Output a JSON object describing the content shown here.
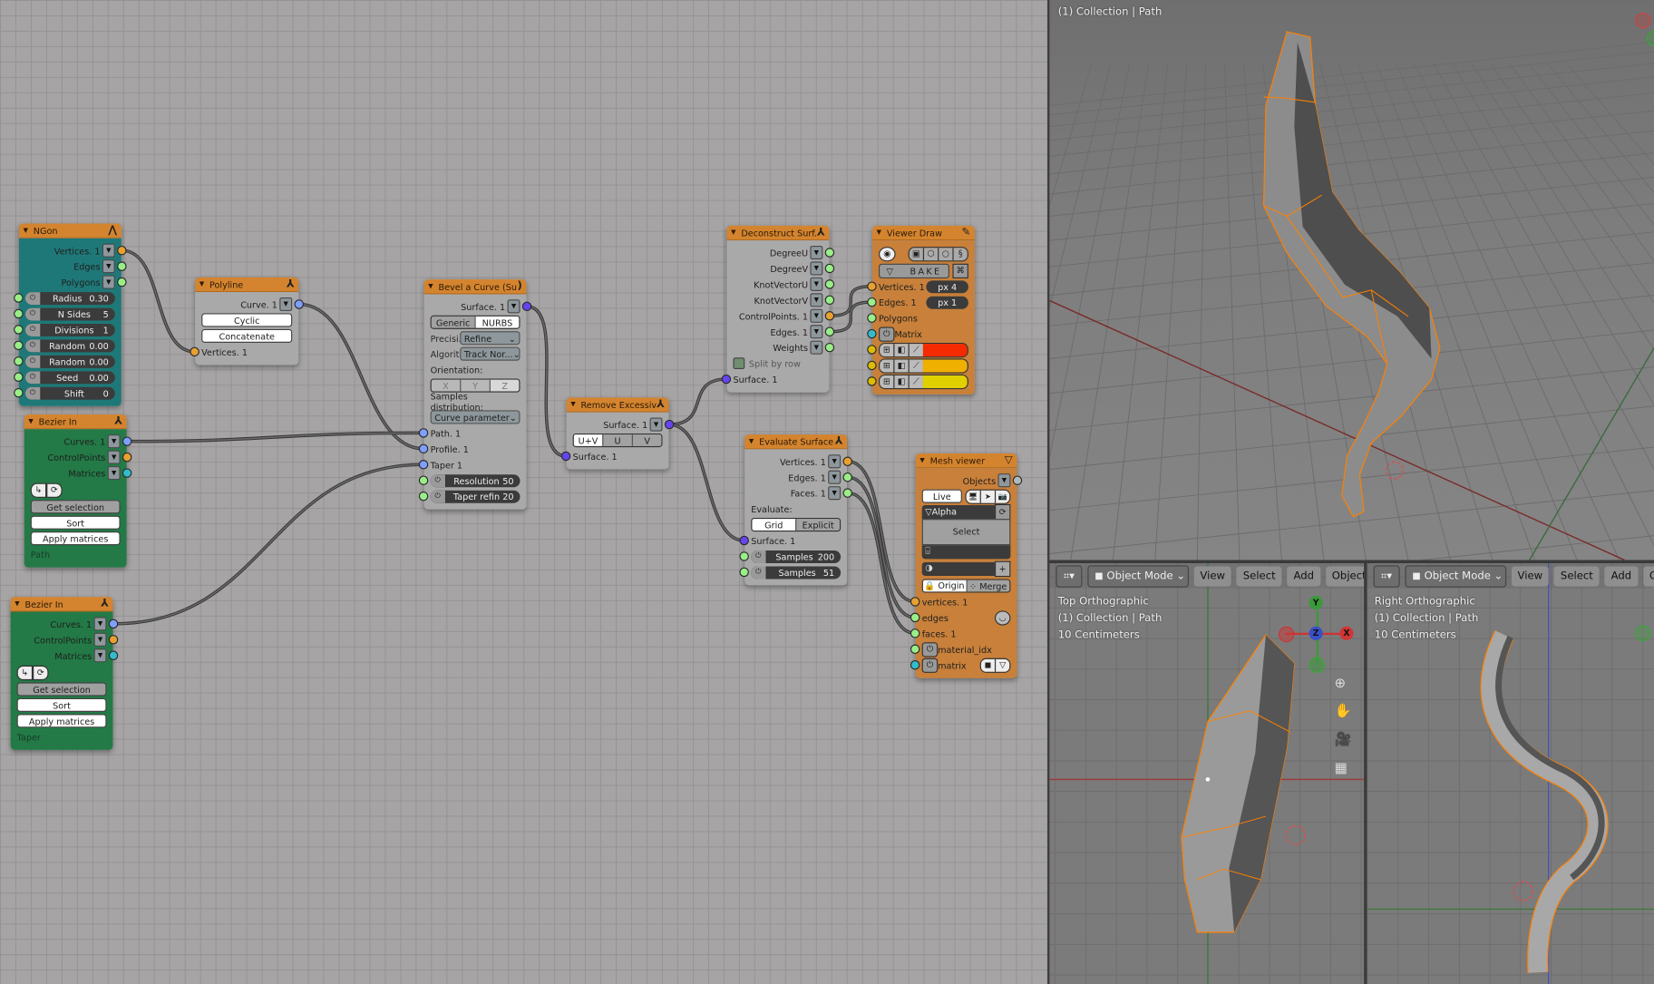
{
  "node_editor": {
    "nodes": [
      {
        "id": "ngon",
        "title": "NGon",
        "header_icon": "ngon-icon",
        "body_color": "#1f7878",
        "rows": [
          {
            "type": "out",
            "label": "Vertices. 1",
            "socket": "#e8a030",
            "s": "verts"
          },
          {
            "type": "out",
            "label": "Edges",
            "socket": "#99ee88",
            "s": "edges"
          },
          {
            "type": "out",
            "label": "Polygons",
            "socket": "#99ee88",
            "s": "polys"
          },
          {
            "type": "slider",
            "label": "Radius",
            "value": "0.30",
            "socket": "#99ee88"
          },
          {
            "type": "slider",
            "label": "N Sides",
            "value": "5",
            "socket": "#99ee88"
          },
          {
            "type": "slider",
            "label": "Divisions",
            "value": "1",
            "socket": "#99ee88"
          },
          {
            "type": "slider",
            "label": "Random",
            "value": "0.00",
            "socket": "#99ee88"
          },
          {
            "type": "slider",
            "label": "Random",
            "value": "0.00",
            "socket": "#99ee88"
          },
          {
            "type": "slider",
            "label": "Seed",
            "value": "0.00",
            "socket": "#99ee88"
          },
          {
            "type": "slider",
            "label": "Shift",
            "value": "0",
            "socket": "#99ee88"
          }
        ]
      },
      {
        "id": "bez_path",
        "title": "Bezier In",
        "header_icon": "sverchok-icon",
        "body_color": "#237a46",
        "rows": [
          {
            "type": "out",
            "label": "Curves. 1",
            "socket": "#7f9fff",
            "s": "curves"
          },
          {
            "type": "out",
            "label": "ControlPoints",
            "socket": "#e8a030",
            "s": "cp"
          },
          {
            "type": "out",
            "label": "Matrices",
            "socket": "#33bbcc",
            "s": "mat"
          },
          {
            "type": "icons",
            "icons": [
              "sort-curve-icon",
              "cycle-icon"
            ]
          },
          {
            "type": "button",
            "label": "Get selection",
            "style": "grey"
          },
          {
            "type": "button",
            "label": "Sort",
            "style": "white"
          },
          {
            "type": "button",
            "label": "Apply matrices",
            "style": "white"
          },
          {
            "type": "text",
            "label": "Path"
          }
        ]
      },
      {
        "id": "bez_taper",
        "title": "Bezier In",
        "header_icon": "sverchok-icon",
        "body_color": "#237a46",
        "rows": [
          {
            "type": "out",
            "label": "Curves. 1",
            "socket": "#7f9fff",
            "s": "curves"
          },
          {
            "type": "out",
            "label": "ControlPoints",
            "socket": "#e8a030",
            "s": "cp"
          },
          {
            "type": "out",
            "label": "Matrices",
            "socket": "#33bbcc",
            "s": "mat"
          },
          {
            "type": "icons",
            "icons": [
              "sort-curve-icon",
              "cycle-icon"
            ]
          },
          {
            "type": "button",
            "label": "Get selection",
            "style": "grey"
          },
          {
            "type": "button",
            "label": "Sort",
            "style": "white"
          },
          {
            "type": "button",
            "label": "Apply matrices",
            "style": "white"
          },
          {
            "type": "text",
            "label": "Taper"
          }
        ]
      },
      {
        "id": "polyline",
        "title": "Polyline",
        "header_icon": "sverchok-icon",
        "body_color": "#a9a9a9",
        "rows": [
          {
            "type": "out",
            "label": "Curve. 1",
            "socket": "#7f9fff",
            "s": "curve"
          },
          {
            "type": "button",
            "label": "Cyclic",
            "style": "white"
          },
          {
            "type": "button",
            "label": "Concatenate",
            "style": "white"
          },
          {
            "type": "in",
            "label": "Vertices. 1",
            "socket": "#e8a030",
            "s": "verts"
          }
        ]
      },
      {
        "id": "bevel",
        "title": "Bevel a Curve (Su...",
        "header_icon": "curve-icon",
        "body_color": "#a9a9a9",
        "rows": [
          {
            "type": "out",
            "label": "Surface. 1",
            "socket": "#6644ee",
            "s": "surf"
          },
          {
            "type": "toggle",
            "options": [
              "Generic",
              "NURBS"
            ],
            "active": 1
          },
          {
            "type": "select",
            "label": "Precisi...",
            "value": "Refine"
          },
          {
            "type": "select",
            "label": "Algorit...",
            "value": "Track Nor..."
          },
          {
            "type": "text",
            "label": "Orientation:"
          },
          {
            "type": "toggle",
            "options": [
              "X",
              "Y",
              "Z"
            ],
            "active": 2,
            "faint": true
          },
          {
            "type": "text",
            "label": "Samples distribution:"
          },
          {
            "type": "select",
            "value": "Curve parameter"
          },
          {
            "type": "in",
            "label": "Path. 1",
            "socket": "#7f9fff",
            "s": "path"
          },
          {
            "type": "in",
            "label": "Profile. 1",
            "socket": "#7f9fff",
            "s": "profile"
          },
          {
            "type": "in",
            "label": "Taper 1",
            "socket": "#7f9fff",
            "s": "taper"
          },
          {
            "type": "slider",
            "label": "Resolution",
            "value": "50",
            "socket": "#99ee88"
          },
          {
            "type": "slider",
            "label": "Taper refin",
            "value": "20",
            "socket": "#99ee88"
          }
        ]
      },
      {
        "id": "remove",
        "title": "Remove Excessiv...",
        "header_icon": "sverchok-icon",
        "body_color": "#a9a9a9",
        "rows": [
          {
            "type": "out",
            "label": "Surface. 1",
            "socket": "#6644ee",
            "s": "surf"
          },
          {
            "type": "toggle",
            "options": [
              "U+V",
              "U",
              "V"
            ],
            "active": 0
          },
          {
            "type": "in",
            "label": "Surface. 1",
            "socket": "#6644ee",
            "s": "in"
          }
        ]
      },
      {
        "id": "decon",
        "title": "Deconstruct Surf...",
        "header_icon": "sverchok-icon",
        "body_color": "#a9a9a9",
        "rows": [
          {
            "type": "out",
            "label": "DegreeU",
            "socket": "#99ee88",
            "s": "du"
          },
          {
            "type": "out",
            "label": "DegreeV",
            "socket": "#99ee88",
            "s": "dv"
          },
          {
            "type": "out",
            "label": "KnotVectorU",
            "socket": "#99ee88",
            "s": "ku"
          },
          {
            "type": "out",
            "label": "KnotVectorV",
            "socket": "#99ee88",
            "s": "kv"
          },
          {
            "type": "out",
            "label": "ControlPoints. 1",
            "socket": "#e8a030",
            "s": "cp"
          },
          {
            "type": "out",
            "label": "Edges. 1",
            "socket": "#99ee88",
            "s": "edges"
          },
          {
            "type": "out",
            "label": "Weights",
            "socket": "#99ee88",
            "s": "w"
          },
          {
            "type": "check",
            "label": "Split by row"
          },
          {
            "type": "in",
            "label": "Surface. 1",
            "socket": "#6644ee",
            "s": "in"
          }
        ]
      },
      {
        "id": "vdraw",
        "title": "Viewer Draw",
        "header_icon": "pencil-icon",
        "body_color": "#c8803a",
        "rows": [
          {
            "type": "icons",
            "icons": [
              "eye-icon"
            ],
            "group": [
              "cube-icon",
              "vertex-icon",
              "circle-icon",
              "wire-icon"
            ]
          },
          {
            "type": "bake",
            "label": "BAKE"
          },
          {
            "type": "inpx",
            "label": "Vertices. 1",
            "value": "px  4",
            "socket": "#e8a030",
            "s": "verts"
          },
          {
            "type": "inpx",
            "label": "Edges. 1",
            "value": "px  1",
            "socket": "#99ee88",
            "s": "edges"
          },
          {
            "type": "in",
            "label": "Polygons",
            "socket": "#99ee88",
            "s": "polys"
          },
          {
            "type": "in",
            "label": "Matrix",
            "socket": "#33bbcc",
            "s": "mat",
            "icon": "plug-icon"
          },
          {
            "type": "color",
            "socket": "#ddbb00",
            "color": "#f52a00"
          },
          {
            "type": "color",
            "socket": "#ddbb00",
            "color": "#f0b000"
          },
          {
            "type": "color",
            "socket": "#ddbb00",
            "color": "#e0d000"
          }
        ]
      },
      {
        "id": "evals",
        "title": "Evaluate Surface",
        "header_icon": "sverchok-icon",
        "body_color": "#a9a9a9",
        "rows": [
          {
            "type": "out",
            "label": "Vertices. 1",
            "socket": "#e8a030",
            "s": "verts"
          },
          {
            "type": "out",
            "label": "Edges. 1",
            "socket": "#99ee88",
            "s": "edges"
          },
          {
            "type": "out",
            "label": "Faces. 1",
            "socket": "#99ee88",
            "s": "faces"
          },
          {
            "type": "text",
            "label": "Evaluate:"
          },
          {
            "type": "toggle",
            "options": [
              "Grid",
              "Explicit"
            ],
            "active": 0
          },
          {
            "type": "in",
            "label": "Surface. 1",
            "socket": "#6644ee",
            "s": "in"
          },
          {
            "type": "slider",
            "label": "Samples",
            "value": "200",
            "socket": "#99ee88"
          },
          {
            "type": "slider",
            "label": "Samples",
            "value": "51",
            "socket": "#99ee88"
          }
        ]
      },
      {
        "id": "mesh",
        "title": "Mesh viewer",
        "header_icon": "mesh-icon",
        "body_color": "#c8803a",
        "rows": [
          {
            "type": "out",
            "label": "Objects",
            "socket": "#b0b8b8",
            "s": "obj"
          },
          {
            "type": "live",
            "label": "Live"
          },
          {
            "type": "alpha",
            "label": "Alpha"
          },
          {
            "type": "selectbox",
            "label": "Select"
          },
          {
            "type": "bar"
          },
          {
            "type": "field"
          },
          {
            "type": "toggle",
            "options": [
              "🔒 Origin",
              "⁘ Merge"
            ],
            "active": 0
          },
          {
            "type": "in",
            "label": "vertices. 1",
            "socket": "#e8a030",
            "s": "verts"
          },
          {
            "type": "in",
            "label": "edges",
            "socket": "#99ee88",
            "s": "edges",
            "extra": "smooth-icon"
          },
          {
            "type": "in",
            "label": "faces. 1",
            "socket": "#99ee88",
            "s": "faces"
          },
          {
            "type": "in",
            "label": "material_idx",
            "socket": "#99ee88",
            "s": "mat",
            "icon": "plug-icon"
          },
          {
            "type": "in",
            "label": "matrix",
            "socket": "#33bbcc",
            "s": "matrix",
            "icon": "plug-icon",
            "extra": "select-icons"
          }
        ]
      }
    ],
    "links": [
      [
        "ngon.verts",
        "polyline.verts"
      ],
      [
        "polyline.curve",
        "bevel.profile"
      ],
      [
        "bez_path.curves",
        "bevel.path"
      ],
      [
        "bez_taper.curves",
        "bevel.taper"
      ],
      [
        "bevel.surf",
        "remove.in"
      ],
      [
        "remove.surf",
        "decon.in"
      ],
      [
        "remove.surf",
        "evals.in"
      ],
      [
        "decon.cp",
        "vdraw.verts"
      ],
      [
        "decon.edges",
        "vdraw.edges"
      ],
      [
        "evals.verts",
        "mesh.verts"
      ],
      [
        "evals.edges",
        "mesh.edges"
      ],
      [
        "evals.faces",
        "mesh.faces"
      ]
    ]
  },
  "viewport_3d": {
    "info": "(1) Collection | Path"
  },
  "viewport_top": {
    "mode": "Object Mode",
    "menus": [
      "View",
      "Select",
      "Add",
      "Object"
    ],
    "view_name": "Top Orthographic",
    "collection": "(1) Collection | Path",
    "scale": "10 Centimeters",
    "gizmo": {
      "x": "X",
      "y": "Y",
      "z": "Z"
    }
  },
  "viewport_right": {
    "mode": "Object Mode",
    "menus": [
      "View",
      "Select",
      "Add",
      "Obj"
    ],
    "view_name": "Right Orthographic",
    "collection": "(1) Collection | Path",
    "scale": "10 Centimeters"
  },
  "colors": {
    "selection": "#ff8000",
    "vertex": "#ff2000",
    "x_axis": "#d03535",
    "y_axis": "#3a9a3a",
    "z_axis": "#3a50c8"
  }
}
